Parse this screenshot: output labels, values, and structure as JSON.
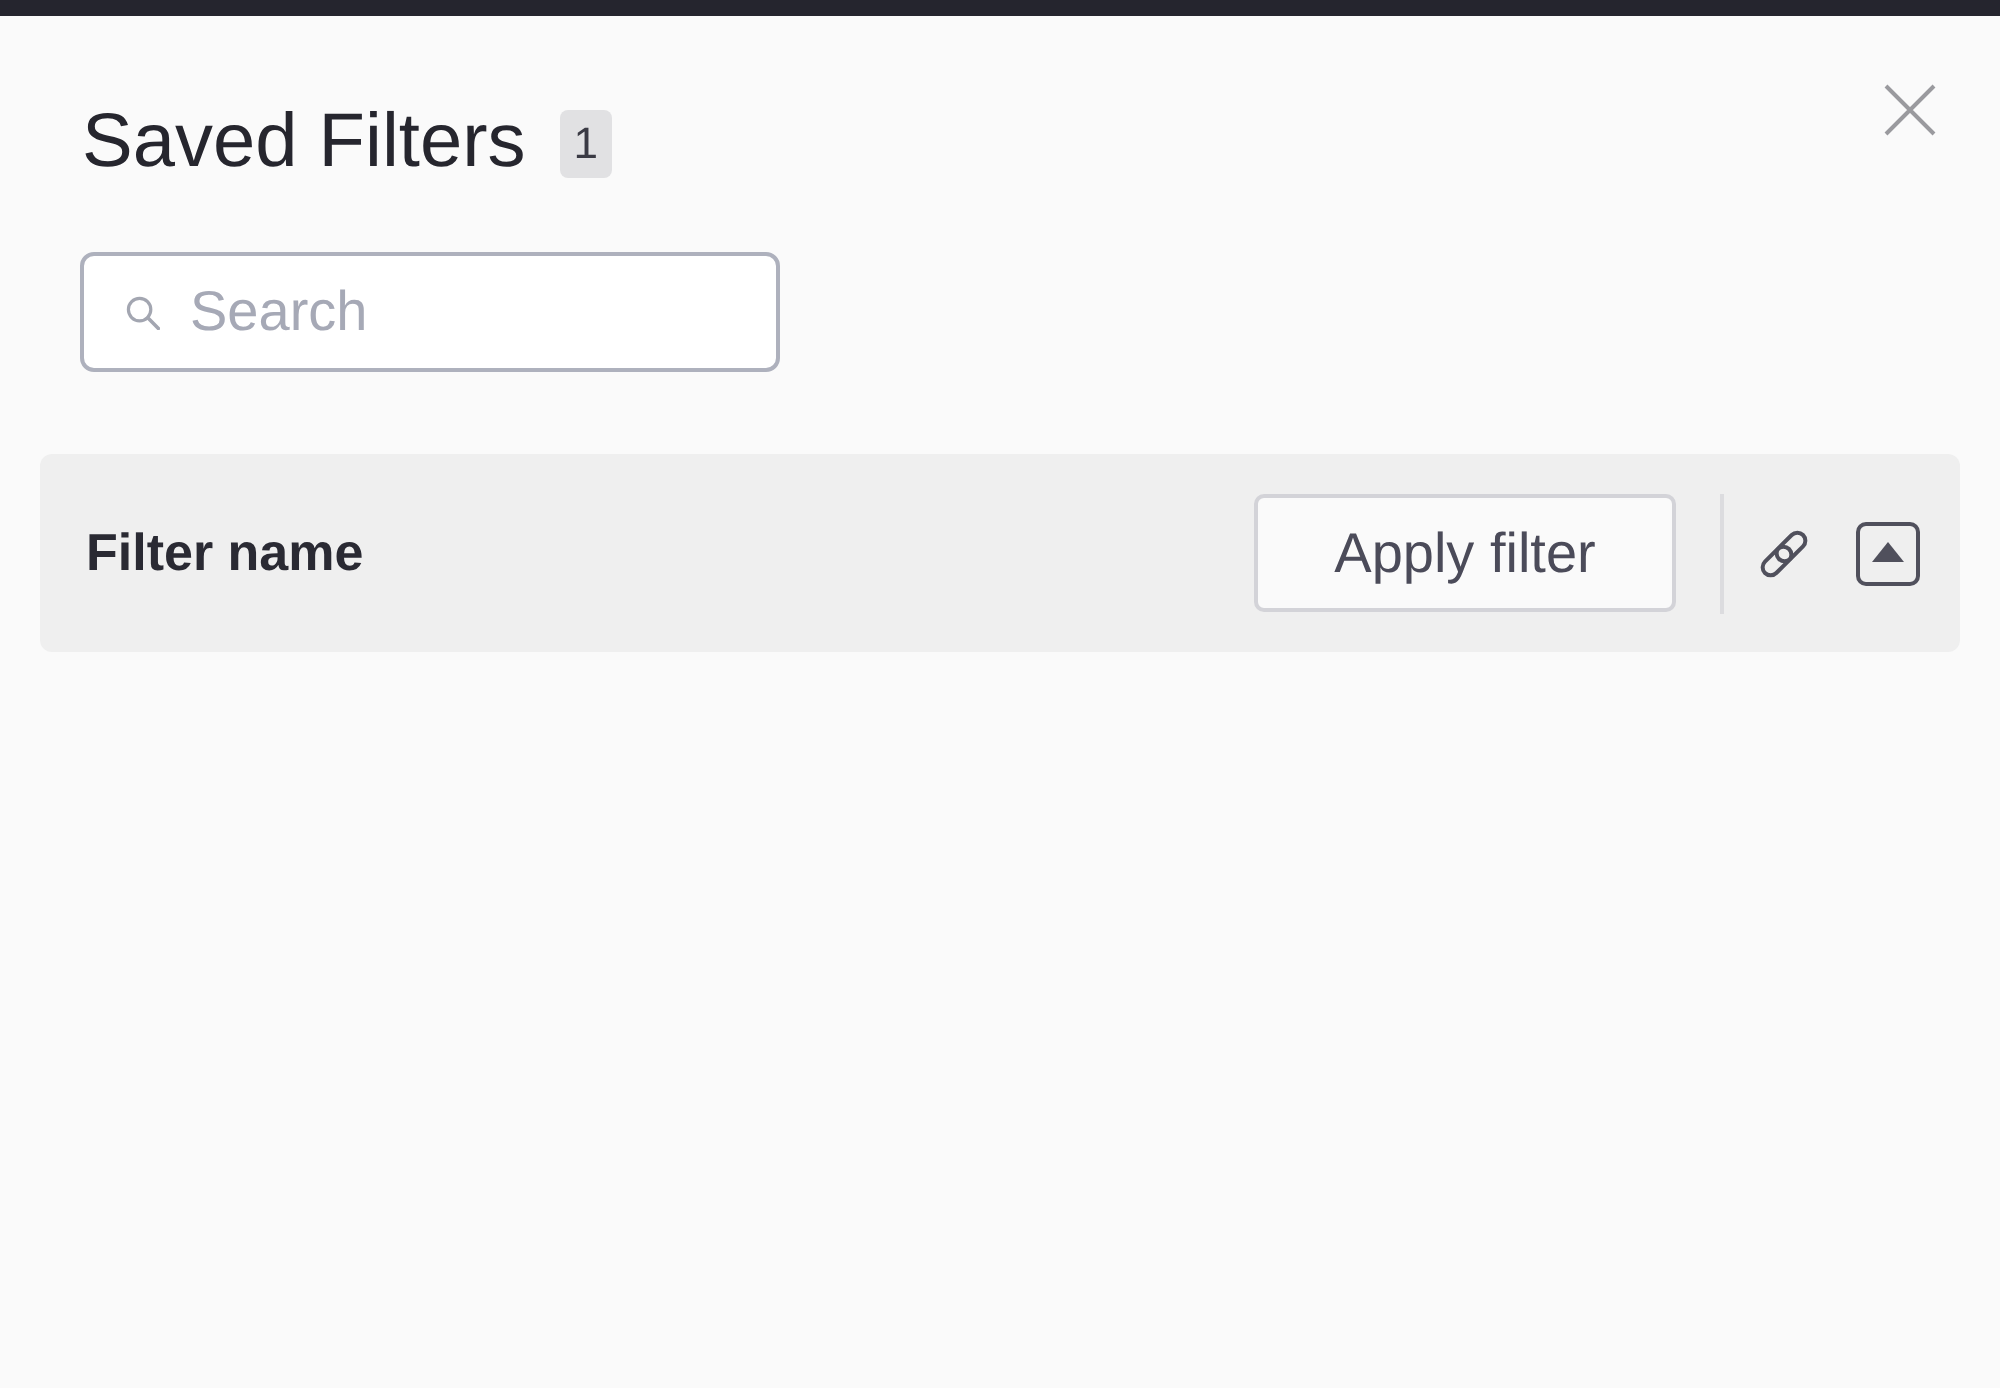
{
  "panel": {
    "title": "Saved Filters",
    "count": "1"
  },
  "search": {
    "placeholder": "Search"
  },
  "filters": [
    {
      "name": "Filter name",
      "apply_label": "Apply filter"
    }
  ]
}
